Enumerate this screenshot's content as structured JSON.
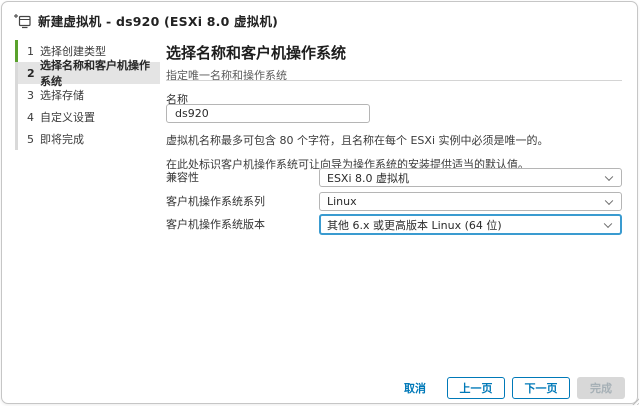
{
  "window": {
    "title": "新建虚拟机 - ds920 (ESXi 8.0 虚拟机)",
    "icon": "new-vm-icon"
  },
  "wizard": {
    "steps": [
      {
        "num": "1",
        "label": "选择创建类型",
        "state": "completed"
      },
      {
        "num": "2",
        "label": "选择名称和客户机操作系统",
        "state": "current"
      },
      {
        "num": "3",
        "label": "选择存储",
        "state": "upcoming"
      },
      {
        "num": "4",
        "label": "自定义设置",
        "state": "upcoming"
      },
      {
        "num": "5",
        "label": "即将完成",
        "state": "upcoming"
      }
    ]
  },
  "content": {
    "heading": "选择名称和客户机操作系统",
    "subheading": "指定唯一名称和操作系统",
    "name_label": "名称",
    "name_value": "ds920",
    "note_name": "虚拟机名称最多可包含 80 个字符，且名称在每个 ESXi 实例中必须是唯一的。",
    "note_os": "在此处标识客户机操作系统可让向导为操作系统的安装提供适当的默认值。",
    "fields": [
      {
        "label": "兼容性",
        "value": "ESXi 8.0 虚拟机",
        "focused": false
      },
      {
        "label": "客户机操作系统系列",
        "value": "Linux",
        "focused": false
      },
      {
        "label": "客户机操作系统版本",
        "value": "其他 6.x 或更高版本 Linux (64 位)",
        "focused": true
      }
    ]
  },
  "footer": {
    "cancel": "取消",
    "back": "上一页",
    "next": "下一页",
    "finish": "完成",
    "finish_enabled": false
  },
  "colors": {
    "accent_blue": "#0079b8",
    "focus_blue": "#3a9bd0",
    "step_done_green": "#5aa22c",
    "current_step_bg": "#e4e4e4",
    "field_border": "#b5b5b5",
    "disabled_bg": "#d8d8d8"
  }
}
